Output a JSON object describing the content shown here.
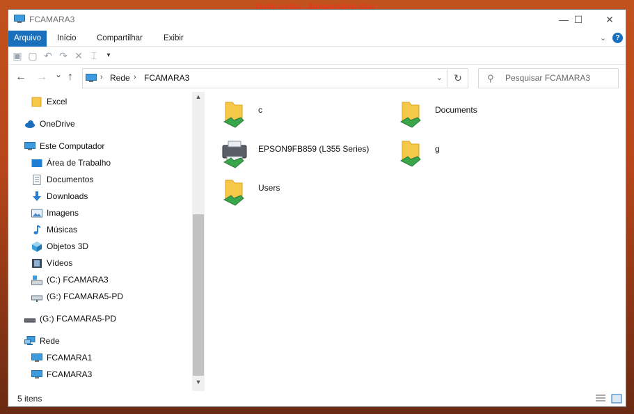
{
  "background": {
    "banner_text": "Todo o dia - Aniversário Gui"
  },
  "window": {
    "title": "FCAMARA3",
    "buttons": {
      "minimize": "—",
      "maximize": "☐",
      "close": "✕"
    }
  },
  "ribbon": {
    "tabs": [
      "Arquivo",
      "Início",
      "Compartilhar",
      "Exibir"
    ],
    "active_tab": "Arquivo",
    "expand_icon": "chevron-down-icon",
    "help_label": "?"
  },
  "navigation": {
    "back_glyph": "←",
    "forward_glyph": "→",
    "recent_glyph": "⌄",
    "up_glyph": "↑",
    "breadcrumb": [
      "Rede",
      "FCAMARA3"
    ],
    "search_placeholder": "Pesquisar FCAMARA3"
  },
  "sidebar": {
    "items": [
      {
        "label": "Excel",
        "icon": "folder-icon"
      },
      {
        "label": "OneDrive",
        "icon": "cloud-icon"
      },
      {
        "label": "Este Computador",
        "icon": "computer-icon"
      },
      {
        "label": "Área de Trabalho",
        "icon": "desktop-icon"
      },
      {
        "label": "Documentos",
        "icon": "documents-icon"
      },
      {
        "label": "Downloads",
        "icon": "download-icon"
      },
      {
        "label": "Imagens",
        "icon": "images-icon"
      },
      {
        "label": "Músicas",
        "icon": "music-icon"
      },
      {
        "label": "Objetos 3D",
        "icon": "cube-icon"
      },
      {
        "label": "Vídeos",
        "icon": "video-icon"
      },
      {
        "label": "(C:) FCAMARA3",
        "icon": "drive-icon"
      },
      {
        "label": "(G:) FCAMARA5-PD",
        "icon": "network-drive-icon"
      },
      {
        "label": "(G:) FCAMARA5-PD",
        "icon": "drive-icon"
      },
      {
        "label": "Rede",
        "icon": "network-icon"
      },
      {
        "label": "FCAMARA1",
        "icon": "computer-icon"
      },
      {
        "label": "FCAMARA3",
        "icon": "computer-icon"
      }
    ]
  },
  "content": {
    "items": [
      {
        "name": "c",
        "icon": "shared-folder-icon"
      },
      {
        "name": "Documents",
        "icon": "shared-folder-icon"
      },
      {
        "name": "EPSON9FB859 (L355 Series)",
        "icon": "printer-icon"
      },
      {
        "name": "g",
        "icon": "shared-folder-icon"
      },
      {
        "name": "Users",
        "icon": "shared-folder-icon"
      }
    ]
  },
  "status": {
    "item_count": "5 itens"
  },
  "colors": {
    "accent": "#1a6fbd",
    "folder": "#f5c84a",
    "share": "#3aa64a"
  }
}
